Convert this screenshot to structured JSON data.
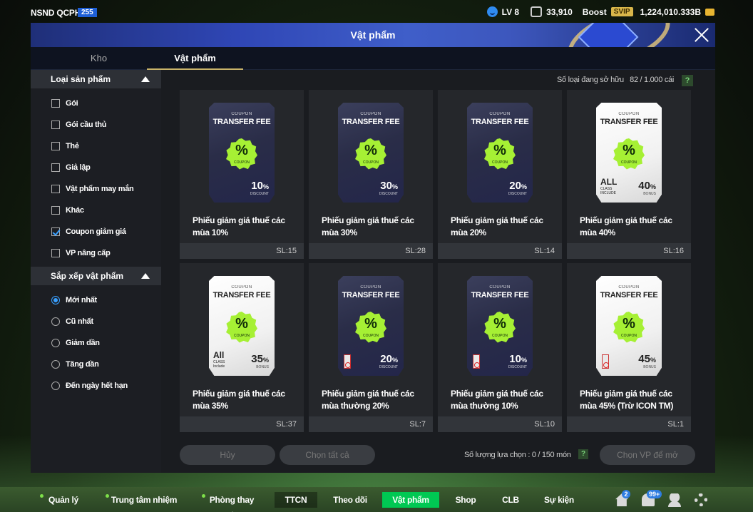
{
  "topbar": {
    "player_name": "NSND QCPH",
    "player_badge": "255",
    "level": "LV 8",
    "points": "33,910",
    "boost_label": "Boost",
    "svip_label": "SVIP",
    "bp": "1,224,010.333B"
  },
  "window": {
    "title": "Vật phẩm",
    "tabs": [
      {
        "label": "Kho"
      },
      {
        "label": "Vật phẩm"
      }
    ],
    "active_tab": "Vật phẩm"
  },
  "sidebar": {
    "product_type_title": "Loại sản phẩm",
    "product_types": [
      {
        "label": "Gói",
        "checked": false
      },
      {
        "label": "Gói cầu thủ",
        "checked": false
      },
      {
        "label": "Thẻ",
        "checked": false
      },
      {
        "label": "Giả lập",
        "checked": false
      },
      {
        "label": "Vật phẩm may mắn",
        "checked": false
      },
      {
        "label": "Khác",
        "checked": false
      },
      {
        "label": "Coupon giảm giá",
        "checked": true
      },
      {
        "label": "VP nâng cấp",
        "checked": false
      }
    ],
    "sort_title": "Sắp xếp vật phẩm",
    "sort_options": [
      {
        "label": "Mới nhất",
        "selected": true
      },
      {
        "label": "Cũ nhất",
        "selected": false
      },
      {
        "label": "Giảm dần",
        "selected": false
      },
      {
        "label": "Tăng dần",
        "selected": false
      },
      {
        "label": "Đến ngày hết hạn",
        "selected": false
      }
    ]
  },
  "main": {
    "owned_label": "Số loại đang sở hữu",
    "owned_value": "82 / 1.000 cái",
    "help": "?",
    "coupon_header": "COUPON",
    "coupon_title": "TRANSFER FEE",
    "coupon_mini": "COUPON",
    "items": [
      {
        "name": "Phiếu giảm giá thuế các mùa 10%",
        "qty": "SL:15",
        "style": "dark",
        "value": "10",
        "value_sub": "DISCOUNT",
        "all": "",
        "all_sub": "",
        "no_icon": false
      },
      {
        "name": "Phiếu giảm giá thuế các mùa 30%",
        "qty": "SL:28",
        "style": "dark",
        "value": "30",
        "value_sub": "DISCOUNT",
        "all": "",
        "all_sub": "",
        "no_icon": false
      },
      {
        "name": "Phiếu giảm giá thuế các mùa 20%",
        "qty": "SL:14",
        "style": "dark",
        "value": "20",
        "value_sub": "DISCOUNT",
        "all": "",
        "all_sub": "",
        "no_icon": false
      },
      {
        "name": "Phiếu giảm giá thuế các mùa 40%",
        "qty": "SL:16",
        "style": "white",
        "value": "40",
        "value_sub": "BONUS",
        "all": "ALL",
        "all_sub": "CLASS INCLUDE",
        "no_icon": false
      },
      {
        "name": "Phiếu giảm giá thuế các mùa 35%",
        "qty": "SL:37",
        "style": "white",
        "value": "35",
        "value_sub": "BONUS",
        "all": "All",
        "all_sub": "CLASS Include",
        "no_icon": false
      },
      {
        "name": "Phiếu giảm giá thuế các mùa thường 20%",
        "qty": "SL:7",
        "style": "dark",
        "value": "20",
        "value_sub": "DISCOUNT",
        "all": "",
        "all_sub": "",
        "no_icon": true
      },
      {
        "name": "Phiếu giảm giá thuế các mùa thường 10%",
        "qty": "SL:10",
        "style": "dark",
        "value": "10",
        "value_sub": "DISCOUNT",
        "all": "",
        "all_sub": "",
        "no_icon": true
      },
      {
        "name": "Phiếu giảm giá thuế các mùa 45% (Trừ ICON TM)",
        "qty": "SL:1",
        "style": "white",
        "value": "45",
        "value_sub": "BONUS",
        "all": "",
        "all_sub": "",
        "no_icon": true
      }
    ],
    "cancel_label": "Hủy",
    "select_all_label": "Chọn tất cả",
    "selected_count": "Số lượng lựa chọn : 0 / 150 món",
    "open_label": "Chọn VP để mở"
  },
  "nav": {
    "items": [
      {
        "label": "Quản lý CT"
      },
      {
        "label": "Trung tâm nhiệm vụ"
      },
      {
        "label": "Phòng thay đồ"
      },
      {
        "label": "TTCN"
      },
      {
        "label": "Theo dõi"
      },
      {
        "label": "Vật phẩm"
      },
      {
        "label": "Shop"
      },
      {
        "label": "CLB"
      },
      {
        "label": "Sự kiện"
      }
    ],
    "home_badge": "2",
    "bell_badge": "99+"
  },
  "colors": {
    "accent_green": "#00c853",
    "coupon_green": "#a6f034",
    "check_blue": "#3aa0ff"
  }
}
